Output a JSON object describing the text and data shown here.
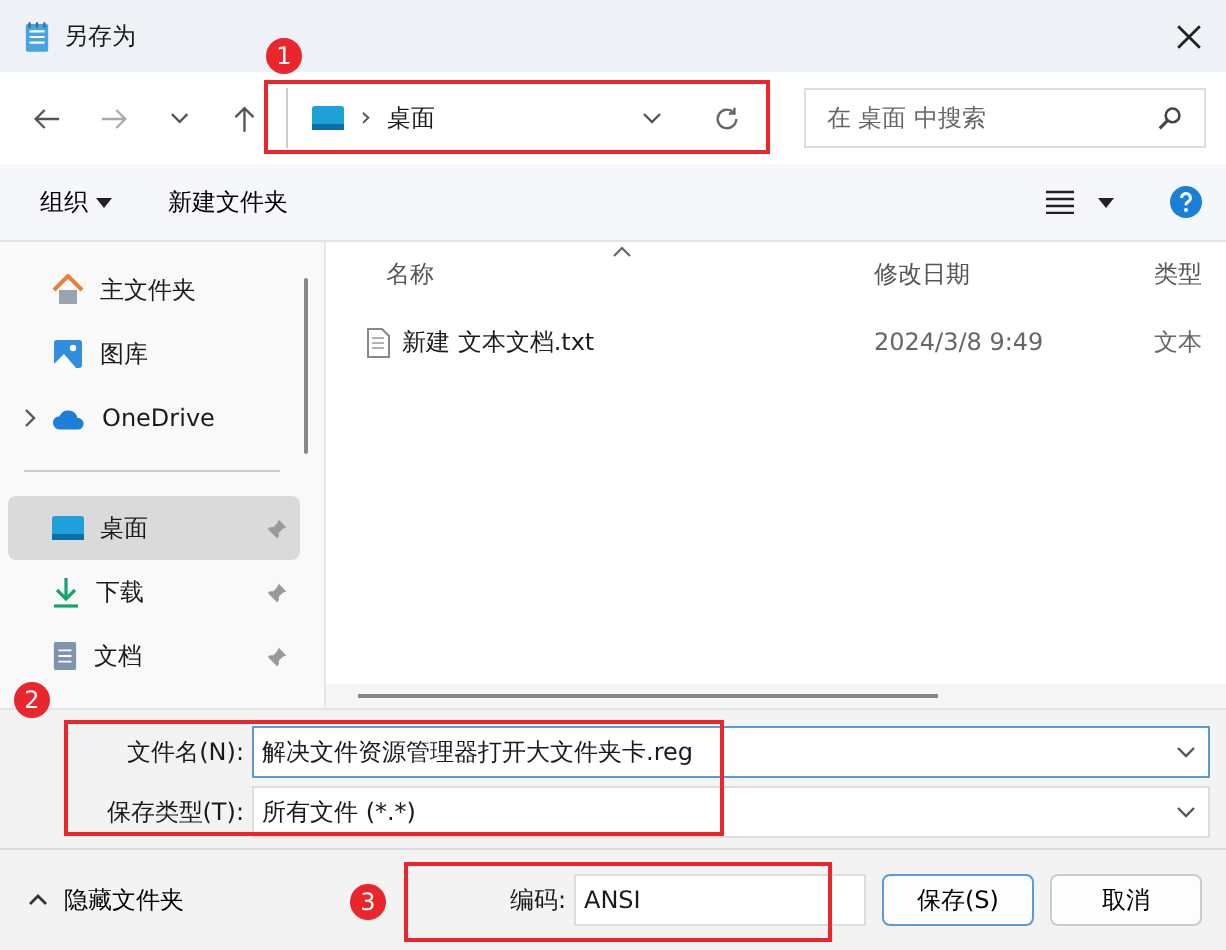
{
  "window": {
    "title": "另存为"
  },
  "nav": {
    "separator": "›",
    "path": "桌面",
    "search_placeholder": "在 桌面 中搜索"
  },
  "toolbar": {
    "organize": "组织",
    "new_folder": "新建文件夹"
  },
  "sidebar": {
    "items": [
      {
        "label": "主文件夹",
        "kind": "home",
        "selected": false,
        "pinned": false,
        "expandable": false
      },
      {
        "label": "图库",
        "kind": "gallery",
        "selected": false,
        "pinned": false,
        "expandable": false
      },
      {
        "label": "OneDrive",
        "kind": "cloud",
        "selected": false,
        "pinned": false,
        "expandable": true
      },
      {
        "label": "桌面",
        "kind": "desktop",
        "selected": true,
        "pinned": true,
        "expandable": false
      },
      {
        "label": "下载",
        "kind": "download",
        "selected": false,
        "pinned": true,
        "expandable": false
      },
      {
        "label": "文档",
        "kind": "document",
        "selected": false,
        "pinned": true,
        "expandable": false
      }
    ]
  },
  "file_list": {
    "columns": [
      "名称",
      "修改日期",
      "类型"
    ],
    "rows": [
      {
        "name": "新建 文本文档.txt",
        "date": "2024/3/8 9:49",
        "type": "文本"
      }
    ]
  },
  "form": {
    "filename_label": "文件名(N):",
    "filename": "解决文件资源管理器打开大文件夹卡.reg",
    "type_label": "保存类型(T):",
    "type": "所有文件  (*.*)"
  },
  "footer": {
    "hide_folders": "隐藏文件夹",
    "encoding_label": "编码:",
    "encoding": "ANSI",
    "save": "保存(S)",
    "cancel": "取消"
  },
  "annotations": [
    "1",
    "2",
    "3"
  ]
}
